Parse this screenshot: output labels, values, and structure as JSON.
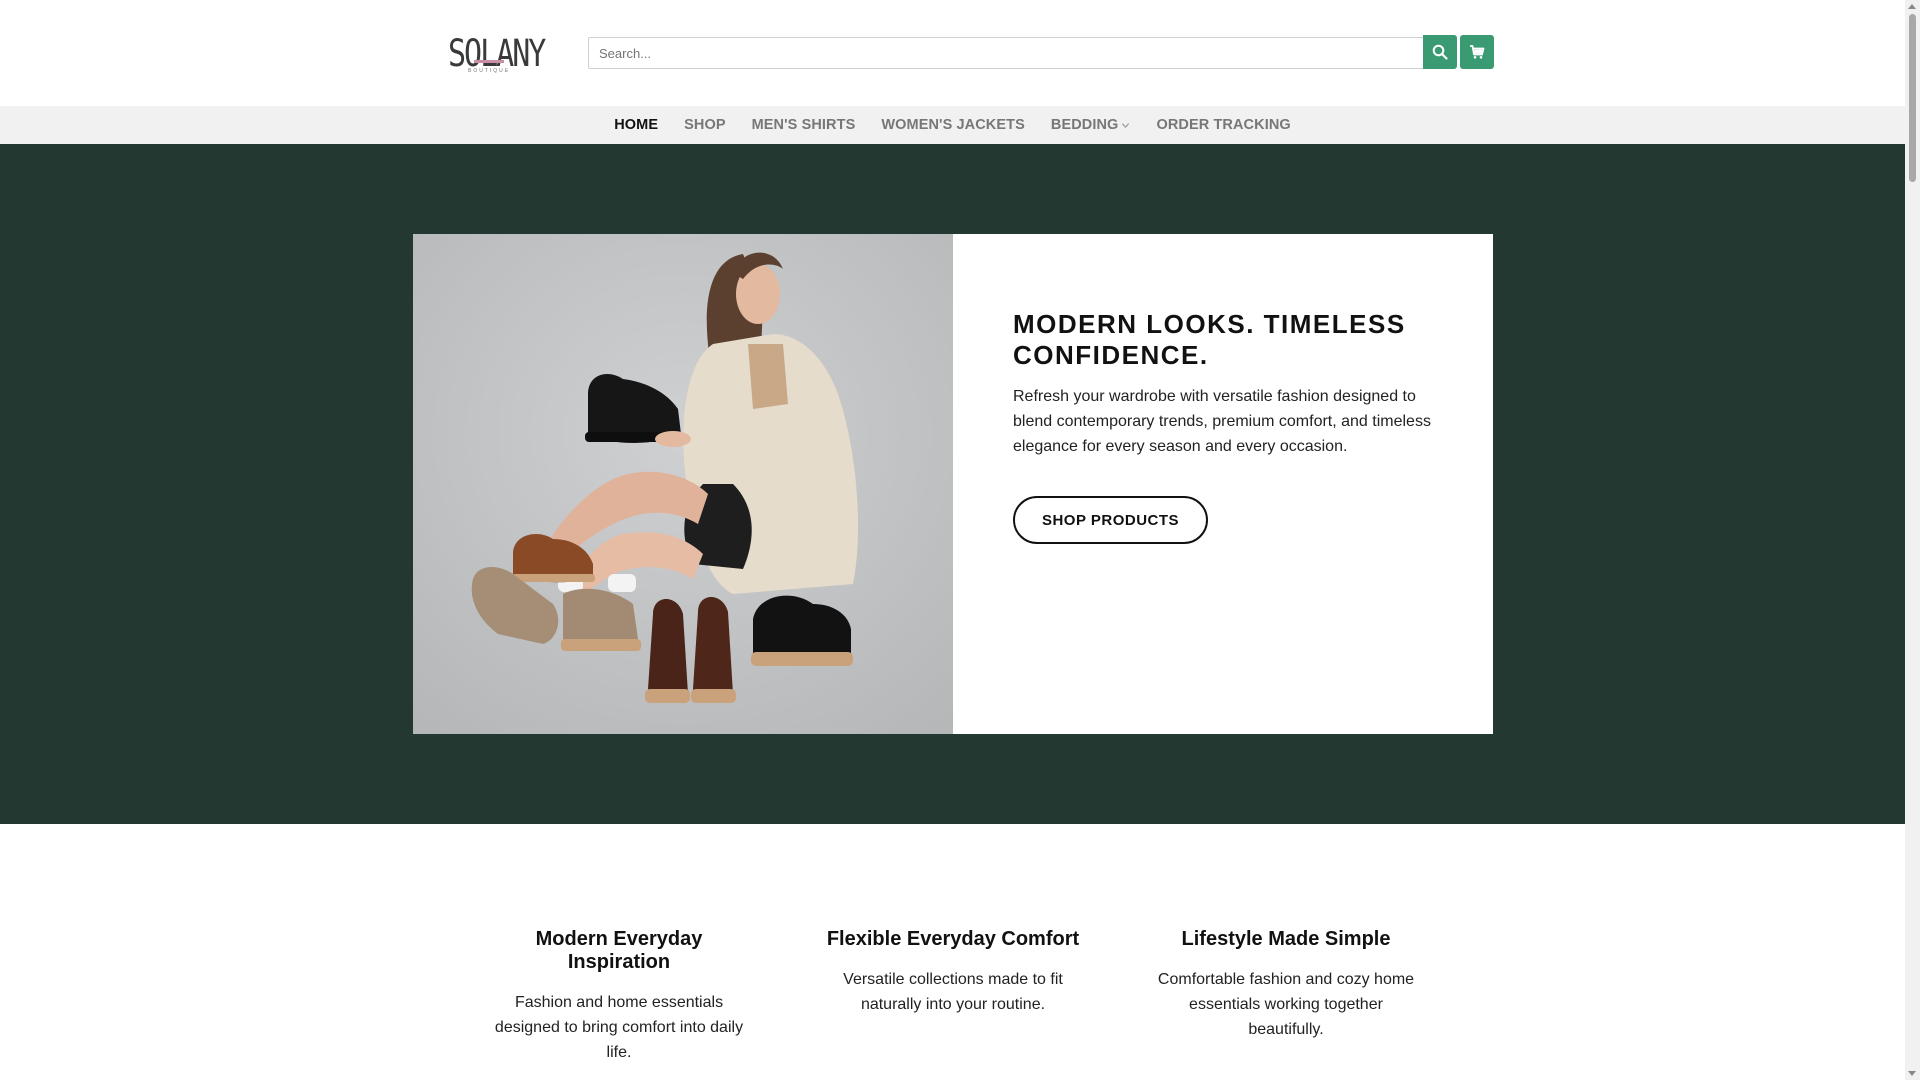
{
  "brand": {
    "logo_text": "SOLANY",
    "logo_sub": "BOUTIQUE",
    "accent_color": "#3a9b72",
    "hero_bg_color": "#223830"
  },
  "header": {
    "search_placeholder": "Search...",
    "search_button_icon": "search-icon",
    "cart_button_icon": "cart-icon"
  },
  "nav": {
    "items": [
      {
        "label": "HOME",
        "active": true
      },
      {
        "label": "SHOP"
      },
      {
        "label": "MEN'S SHIRTS"
      },
      {
        "label": "WOMEN'S JACKETS"
      },
      {
        "label": "BEDDING",
        "has_dropdown": true
      },
      {
        "label": "ORDER TRACKING"
      }
    ]
  },
  "hero": {
    "title": "MODERN LOOKS. TIMELESS CONFIDENCE.",
    "text": "Refresh your wardrobe with versatile fashion designed to blend contemporary trends, premium comfort, and timeless elegance for every season and every occasion.",
    "button_label": "SHOP PRODUCTS"
  },
  "features": [
    {
      "title": "Modern Everyday Inspiration",
      "text": "Fashion and home essentials designed to bring comfort into daily life."
    },
    {
      "title": "Flexible Everyday Comfort",
      "text": "Versatile collections made to fit naturally into your routine."
    },
    {
      "title": "Lifestyle Made Simple",
      "text": "Comfortable fashion and cozy home essentials working together beautifully."
    }
  ]
}
